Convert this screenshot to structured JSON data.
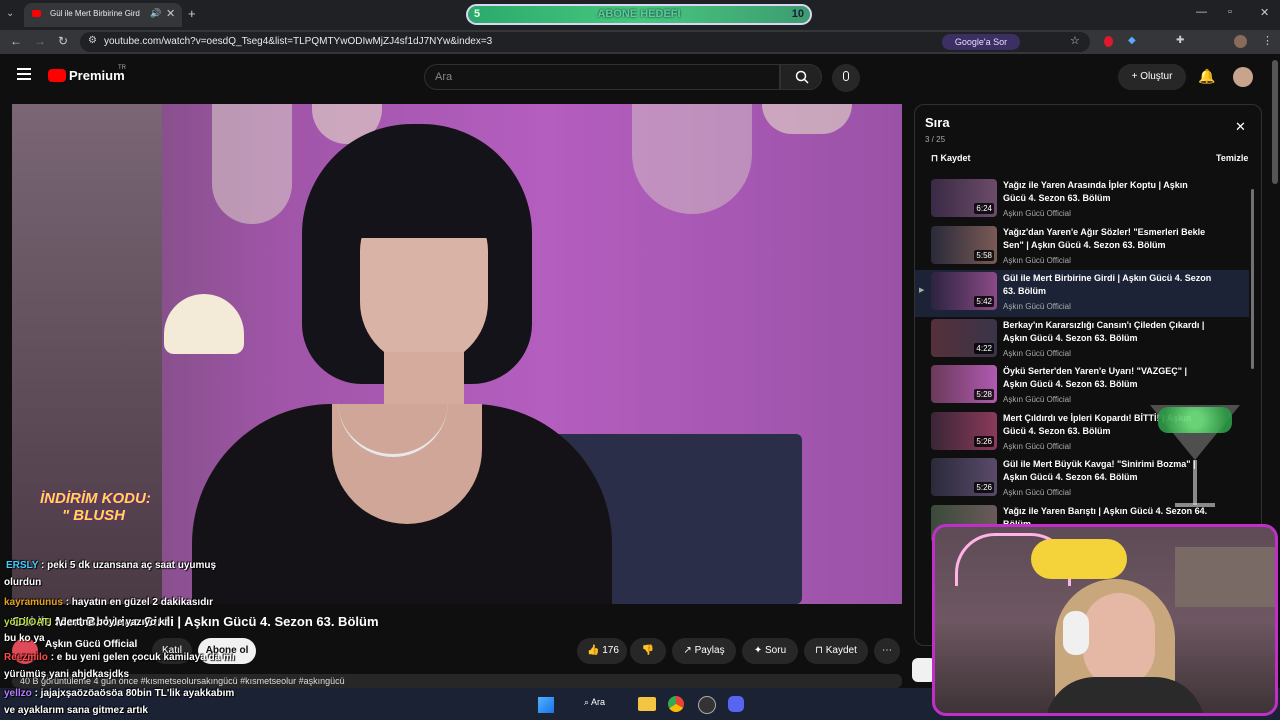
{
  "browser": {
    "tab_title": "Gül ile Mert Birbirine Girdi",
    "url": "youtube.com/watch?v=oesdQ_Tseg4&list=TLPQMTYwODIwMjZJ4sf1dJ7NYw&index=3",
    "google_sor": "Google'a Sor"
  },
  "goal_overlay": {
    "start": "5",
    "label": "ABONE HEDEFI",
    "end": "10"
  },
  "youtube": {
    "logo": "Premium",
    "logo_region": "TR",
    "search_placeholder": "Ara",
    "create_label": "Oluştur"
  },
  "video": {
    "promo_line1": "İNDİRİM KODU:",
    "promo_line2": "\" BLUSH",
    "title": "Gül ile Mert Birbirine Girdi | Aşkın Gücü 4. Sezon 63. Bölüm",
    "channel": "Aşkın Gücü Official",
    "join_label": "Katıl",
    "subscribe_label": "Abone ol",
    "likes": "176",
    "share_label": "Paylaş",
    "ask_label": "Soru",
    "save_label": "Kaydet",
    "views_line": "40 B görüntüleme  4 gün önce  #kısmetseolursakıngücü #kısmetseolur #aşkıngücü"
  },
  "chat": [
    {
      "user": "ERSLY",
      "text": ": peki 5 dk uzansana aç saat uyumuş",
      "color": "#3ecfff"
    },
    {
      "user": "",
      "text": "olurdun",
      "color": "#ffffff"
    },
    {
      "user": "kayramunus",
      "text": ": hayatın en güzel 2 dakikasıdır",
      "color": "#e6a21a"
    },
    {
      "user": "yöiDIOATI",
      "text": ": dert ne boyle yazıyo ki",
      "color": "#b6e03a"
    },
    {
      "user": "",
      "text": "bu ko ya",
      "color": "#ffffff"
    },
    {
      "user": "Reezmilo",
      "text": ": e bu yeni gelen çocuk kamilaya da mı",
      "color": "#ff4a4a"
    },
    {
      "user": "",
      "text": "yürümüş yani ahjdkasjdks",
      "color": "#ffffff"
    },
    {
      "user": "yellzo",
      "text": ": jajajxşaözöaösöa 80bin TL'lik ayakkabım",
      "color": "#b97cff"
    },
    {
      "user": "",
      "text": "ve ayaklarım sana gitmez artık",
      "color": "#ffffff"
    }
  ],
  "queue": {
    "title": "Sıra",
    "position": "3 / 25",
    "save_label": "Kaydet",
    "clear_label": "Temizle",
    "items": [
      {
        "title": "Yağız ile Yaren Arasında İpler Koptu | Aşkın Gücü 4. Sezon 63. Bölüm",
        "duration": "6:24",
        "channel": "Aşkın Gücü Official"
      },
      {
        "title": "Yağız'dan Yaren'e Ağır Sözler! \"Esmerleri Bekle Sen\" | Aşkın Gücü 4. Sezon 63. Bölüm",
        "duration": "5:58",
        "channel": "Aşkın Gücü Official"
      },
      {
        "title": "Gül ile Mert Birbirine Girdi | Aşkın Gücü 4. Sezon 63. Bölüm",
        "duration": "5:42",
        "channel": "Aşkın Gücü Official"
      },
      {
        "title": "Berkay'ın Kararsızlığı Cansın'ı Çileden Çıkardı | Aşkın Gücü 4. Sezon 63. Bölüm",
        "duration": "4:22",
        "channel": "Aşkın Gücü Official"
      },
      {
        "title": "Öykü Serter'den Yaren'e Uyarı! \"VAZGEÇ\" | Aşkın Gücü 4. Sezon 63. Bölüm",
        "duration": "5:28",
        "channel": "Aşkın Gücü Official"
      },
      {
        "title": "Mert Çıldırdı ve İpleri Kopardı! BİTTİ! | Aşkın Gücü 4. Sezon 63. Bölüm",
        "duration": "5:26",
        "channel": "Aşkın Gücü Official"
      },
      {
        "title": "Gül ile Mert Büyük Kavga! \"Sinirimi Bozma\" | Aşkın Gücü 4. Sezon 64. Bölüm",
        "duration": "5:26",
        "channel": "Aşkın Gücü Official"
      },
      {
        "title": "Yağız ile Yaren Barıştı | Aşkın Gücü 4. Sezon 64. Bölüm",
        "duration": "",
        "channel": ""
      }
    ]
  },
  "taskbar": {
    "search_label": "Ara"
  }
}
